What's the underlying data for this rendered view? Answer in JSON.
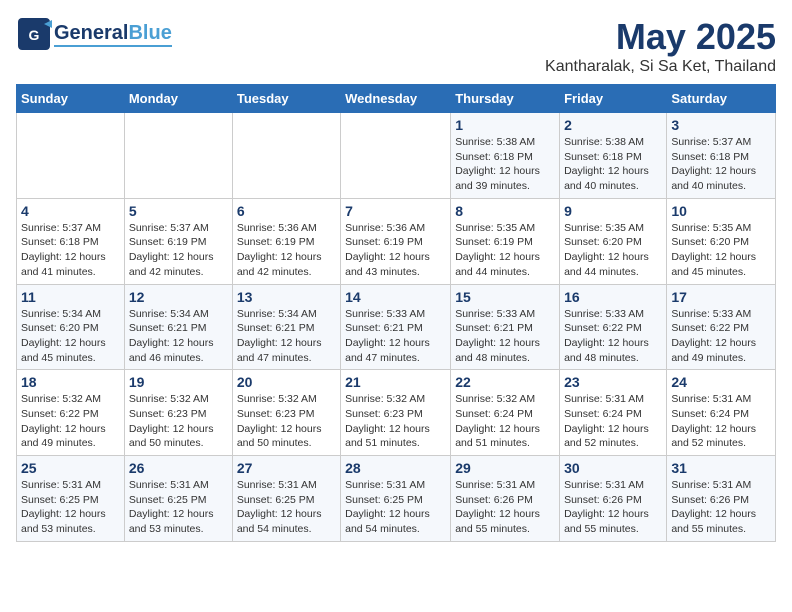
{
  "header": {
    "logo_general": "General",
    "logo_blue": "Blue",
    "month_title": "May 2025",
    "location": "Kantharalak, Si Sa Ket, Thailand"
  },
  "days_of_week": [
    "Sunday",
    "Monday",
    "Tuesday",
    "Wednesday",
    "Thursday",
    "Friday",
    "Saturday"
  ],
  "weeks": [
    [
      {
        "day": "",
        "info": ""
      },
      {
        "day": "",
        "info": ""
      },
      {
        "day": "",
        "info": ""
      },
      {
        "day": "",
        "info": ""
      },
      {
        "day": "1",
        "info": "Sunrise: 5:38 AM\nSunset: 6:18 PM\nDaylight: 12 hours\nand 39 minutes."
      },
      {
        "day": "2",
        "info": "Sunrise: 5:38 AM\nSunset: 6:18 PM\nDaylight: 12 hours\nand 40 minutes."
      },
      {
        "day": "3",
        "info": "Sunrise: 5:37 AM\nSunset: 6:18 PM\nDaylight: 12 hours\nand 40 minutes."
      }
    ],
    [
      {
        "day": "4",
        "info": "Sunrise: 5:37 AM\nSunset: 6:18 PM\nDaylight: 12 hours\nand 41 minutes."
      },
      {
        "day": "5",
        "info": "Sunrise: 5:37 AM\nSunset: 6:19 PM\nDaylight: 12 hours\nand 42 minutes."
      },
      {
        "day": "6",
        "info": "Sunrise: 5:36 AM\nSunset: 6:19 PM\nDaylight: 12 hours\nand 42 minutes."
      },
      {
        "day": "7",
        "info": "Sunrise: 5:36 AM\nSunset: 6:19 PM\nDaylight: 12 hours\nand 43 minutes."
      },
      {
        "day": "8",
        "info": "Sunrise: 5:35 AM\nSunset: 6:19 PM\nDaylight: 12 hours\nand 44 minutes."
      },
      {
        "day": "9",
        "info": "Sunrise: 5:35 AM\nSunset: 6:20 PM\nDaylight: 12 hours\nand 44 minutes."
      },
      {
        "day": "10",
        "info": "Sunrise: 5:35 AM\nSunset: 6:20 PM\nDaylight: 12 hours\nand 45 minutes."
      }
    ],
    [
      {
        "day": "11",
        "info": "Sunrise: 5:34 AM\nSunset: 6:20 PM\nDaylight: 12 hours\nand 45 minutes."
      },
      {
        "day": "12",
        "info": "Sunrise: 5:34 AM\nSunset: 6:21 PM\nDaylight: 12 hours\nand 46 minutes."
      },
      {
        "day": "13",
        "info": "Sunrise: 5:34 AM\nSunset: 6:21 PM\nDaylight: 12 hours\nand 47 minutes."
      },
      {
        "day": "14",
        "info": "Sunrise: 5:33 AM\nSunset: 6:21 PM\nDaylight: 12 hours\nand 47 minutes."
      },
      {
        "day": "15",
        "info": "Sunrise: 5:33 AM\nSunset: 6:21 PM\nDaylight: 12 hours\nand 48 minutes."
      },
      {
        "day": "16",
        "info": "Sunrise: 5:33 AM\nSunset: 6:22 PM\nDaylight: 12 hours\nand 48 minutes."
      },
      {
        "day": "17",
        "info": "Sunrise: 5:33 AM\nSunset: 6:22 PM\nDaylight: 12 hours\nand 49 minutes."
      }
    ],
    [
      {
        "day": "18",
        "info": "Sunrise: 5:32 AM\nSunset: 6:22 PM\nDaylight: 12 hours\nand 49 minutes."
      },
      {
        "day": "19",
        "info": "Sunrise: 5:32 AM\nSunset: 6:23 PM\nDaylight: 12 hours\nand 50 minutes."
      },
      {
        "day": "20",
        "info": "Sunrise: 5:32 AM\nSunset: 6:23 PM\nDaylight: 12 hours\nand 50 minutes."
      },
      {
        "day": "21",
        "info": "Sunrise: 5:32 AM\nSunset: 6:23 PM\nDaylight: 12 hours\nand 51 minutes."
      },
      {
        "day": "22",
        "info": "Sunrise: 5:32 AM\nSunset: 6:24 PM\nDaylight: 12 hours\nand 51 minutes."
      },
      {
        "day": "23",
        "info": "Sunrise: 5:31 AM\nSunset: 6:24 PM\nDaylight: 12 hours\nand 52 minutes."
      },
      {
        "day": "24",
        "info": "Sunrise: 5:31 AM\nSunset: 6:24 PM\nDaylight: 12 hours\nand 52 minutes."
      }
    ],
    [
      {
        "day": "25",
        "info": "Sunrise: 5:31 AM\nSunset: 6:25 PM\nDaylight: 12 hours\nand 53 minutes."
      },
      {
        "day": "26",
        "info": "Sunrise: 5:31 AM\nSunset: 6:25 PM\nDaylight: 12 hours\nand 53 minutes."
      },
      {
        "day": "27",
        "info": "Sunrise: 5:31 AM\nSunset: 6:25 PM\nDaylight: 12 hours\nand 54 minutes."
      },
      {
        "day": "28",
        "info": "Sunrise: 5:31 AM\nSunset: 6:25 PM\nDaylight: 12 hours\nand 54 minutes."
      },
      {
        "day": "29",
        "info": "Sunrise: 5:31 AM\nSunset: 6:26 PM\nDaylight: 12 hours\nand 55 minutes."
      },
      {
        "day": "30",
        "info": "Sunrise: 5:31 AM\nSunset: 6:26 PM\nDaylight: 12 hours\nand 55 minutes."
      },
      {
        "day": "31",
        "info": "Sunrise: 5:31 AM\nSunset: 6:26 PM\nDaylight: 12 hours\nand 55 minutes."
      }
    ]
  ]
}
